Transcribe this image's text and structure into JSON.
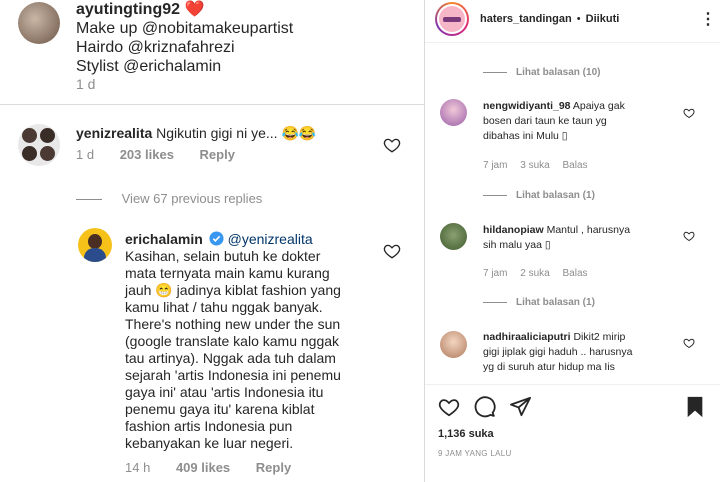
{
  "left": {
    "comment1": {
      "username": "ayutingting92",
      "emoji": "❤️",
      "lines": [
        "Make up @nobitamakeupartist",
        "Hairdo @kriznafahrezi",
        "Stylist @erichalamin"
      ],
      "time": "1 d"
    },
    "comment2": {
      "username": "yenizrealita",
      "text": "Ngikutin gigi ni ye... 😂😂",
      "time": "1 d",
      "likes": "203 likes",
      "reply": "Reply"
    },
    "view_previous": "View 67 previous replies",
    "comment3": {
      "username": "erichalamin",
      "mention": "@yenizrealita",
      "lines": [
        "Kasihan, selain butuh ke dokter",
        "mata ternyata main kamu kurang",
        "jauh 😁 jadinya kiblat fashion yang",
        "kamu lihat / tahu nggak banyak.",
        "There's nothing new under the sun",
        "(google translate kalo kamu nggak",
        "tau artinya). Nggak ada tuh dalam",
        "sejarah 'artis Indonesia ini penemu",
        "gaya ini' atau 'artis Indonesia itu",
        "penemu gaya itu' karena kiblat",
        "fashion artis Indonesia pun",
        "kebanyakan ke luar negeri."
      ],
      "time": "14 h",
      "likes": "409 likes",
      "reply": "Reply"
    }
  },
  "right": {
    "header": {
      "username": "haters_tandingan",
      "separator": "•",
      "follow_state": "Diikuti",
      "more": "⋮"
    },
    "view_replies_1": "Lihat balasan (10)",
    "comment_a": {
      "username": "nengwidiyanti_98",
      "text": "Apaiya gak bosen dari taun ke taun yg dibahas ini Mulu 😕",
      "line1": "Apaiya gak",
      "line2": "bosen dari taun ke taun yg",
      "line3": "dibahas ini Mulu ▯",
      "time": "7 jam",
      "likes": "3 suka",
      "reply": "Balas"
    },
    "view_replies_2": "Lihat balasan (1)",
    "comment_b": {
      "username": "hildanopiaw",
      "line1": "Mantul , harusnya",
      "line2": "sih malu yaa ▯",
      "time": "7 jam",
      "likes": "2 suka",
      "reply": "Balas"
    },
    "view_replies_3": "Lihat balasan (1)",
    "comment_c": {
      "username": "nadhiraaliciaputri",
      "line1": "Dikit2 mirip",
      "line2": "gigi jiplak gigi haduh .. harusnya",
      "line3": "yg di suruh atur hidup ma Iis"
    },
    "likes_count": "1,136 suka",
    "timestamp": "9 JAM YANG LALU"
  }
}
